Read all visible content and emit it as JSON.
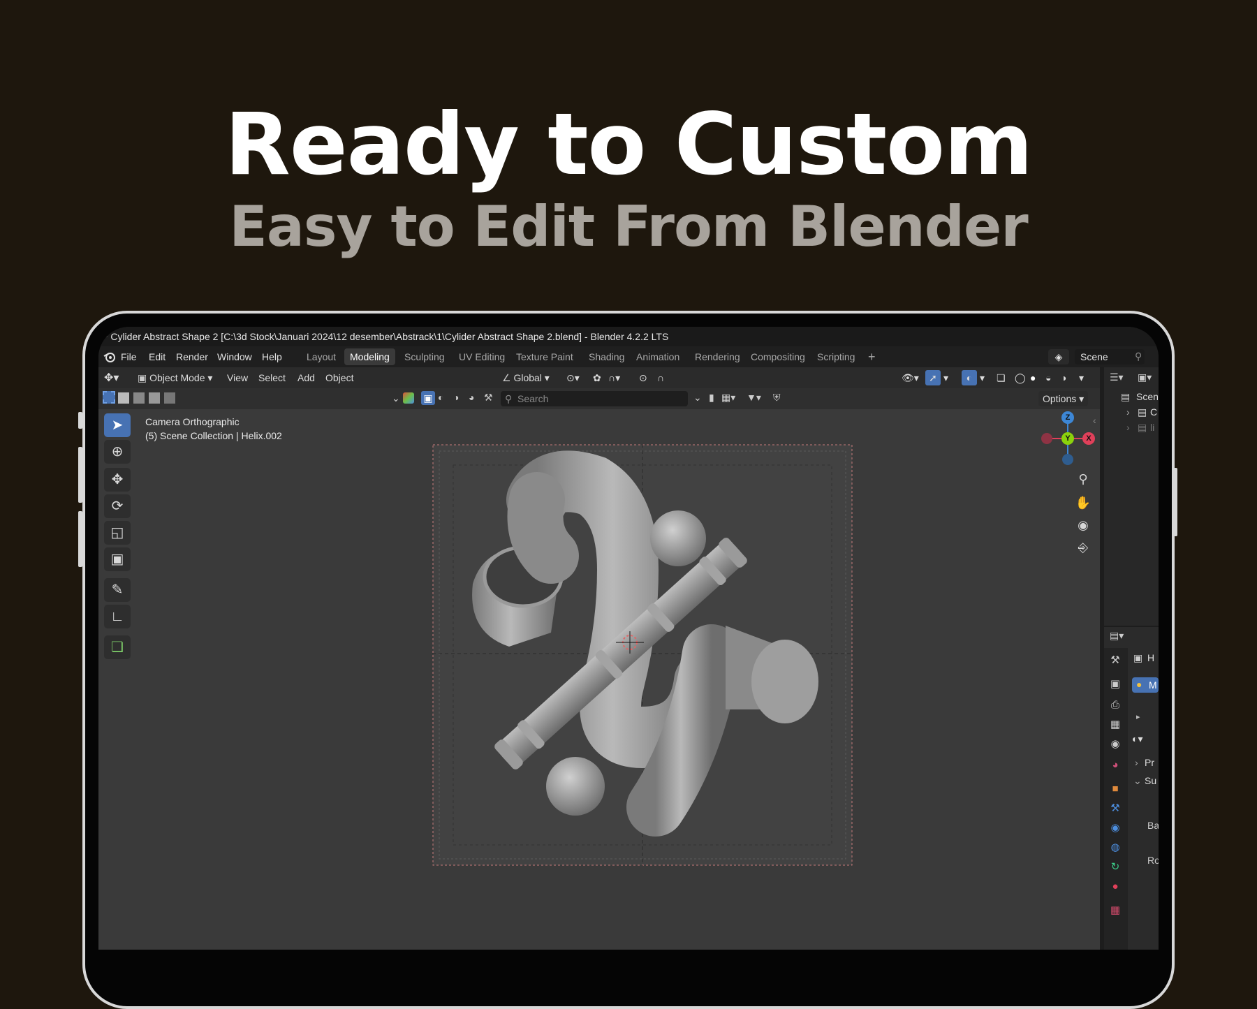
{
  "hero": {
    "title": "Ready to Custom",
    "subtitle": "Easy to Edit From Blender"
  },
  "window": {
    "title": "* Cylider Abstract Shape 2 [C:\\3d Stock\\Januari 2024\\12 desember\\Abstrack\\1\\Cylider Abstract Shape 2.blend] - Blender 4.2.2 LTS"
  },
  "menu": [
    "File",
    "Edit",
    "Render",
    "Window",
    "Help"
  ],
  "workspaces": [
    {
      "label": "Layout",
      "active": false
    },
    {
      "label": "Modeling",
      "active": true
    },
    {
      "label": "Sculpting",
      "active": false
    },
    {
      "label": "UV Editing",
      "active": false
    },
    {
      "label": "Texture Paint",
      "active": false
    },
    {
      "label": "Shading",
      "active": false
    },
    {
      "label": "Animation",
      "active": false
    },
    {
      "label": "Rendering",
      "active": false
    },
    {
      "label": "Compositing",
      "active": false
    },
    {
      "label": "Scripting",
      "active": false
    }
  ],
  "scene": {
    "label": "Scene"
  },
  "viewport_header": {
    "mode": "Object Mode",
    "menus": [
      "View",
      "Select",
      "Add",
      "Object"
    ],
    "transform_orientation": "Global",
    "options": "Options"
  },
  "search": {
    "placeholder": "Search"
  },
  "overlay": {
    "line1": "Camera Orthographic",
    "line2": "(5) Scene Collection | Helix.002"
  },
  "gizmo": {
    "z": "Z",
    "y": "Y",
    "x": "X"
  },
  "outliner": {
    "scene_label": "Scen",
    "row1": "C",
    "row2": "li"
  },
  "properties": {
    "name_stub": "H",
    "material_stub": "M",
    "panel1": "Pr",
    "panel2": "Su",
    "field1": "Ba",
    "field2": "Ro"
  },
  "colors": {
    "accent": "#4772b3",
    "background": "#1e170d",
    "axis_x": "#e0405a",
    "axis_y": "#8bd20c",
    "axis_z": "#3d87d6"
  }
}
